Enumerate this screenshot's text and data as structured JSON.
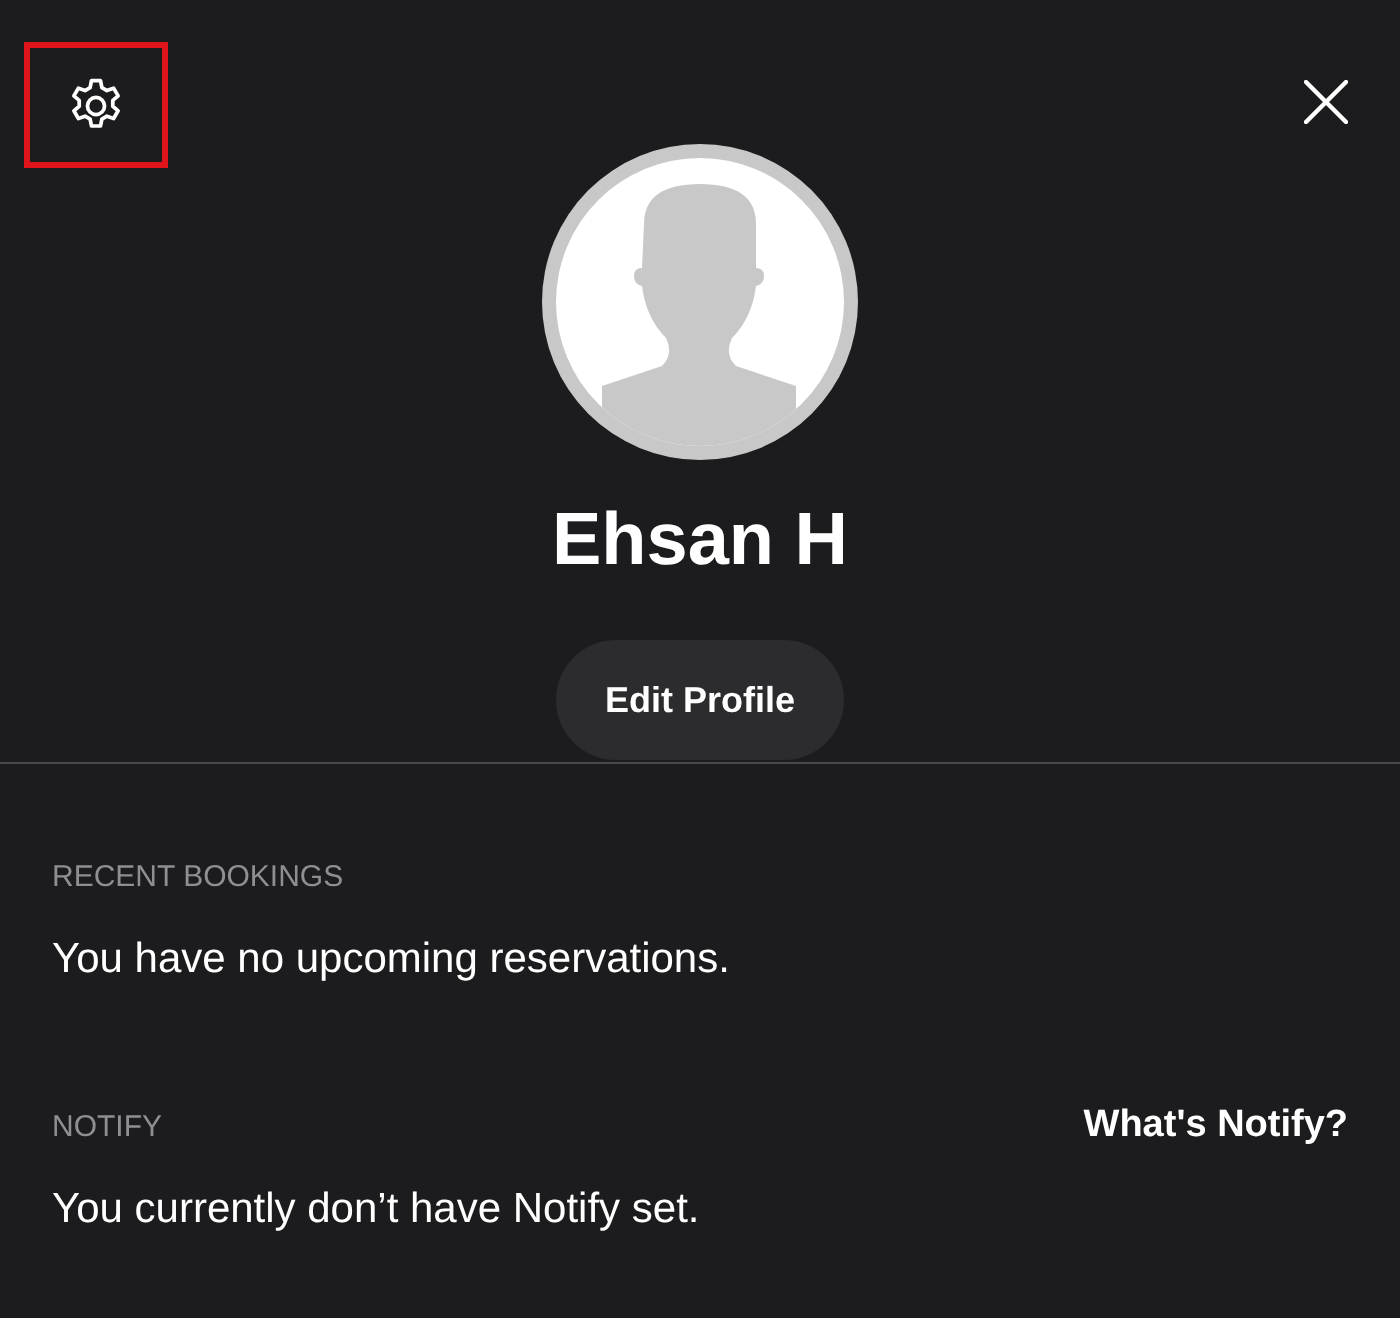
{
  "header": {
    "settings_highlighted": true
  },
  "profile": {
    "name": "Ehsan H",
    "edit_button": "Edit Profile"
  },
  "sections": [
    {
      "heading": "RECENT BOOKINGS",
      "message": "You have no upcoming reservations."
    },
    {
      "heading": "NOTIFY",
      "link": "What's Notify?",
      "message": "You currently don’t have Notify set."
    }
  ]
}
